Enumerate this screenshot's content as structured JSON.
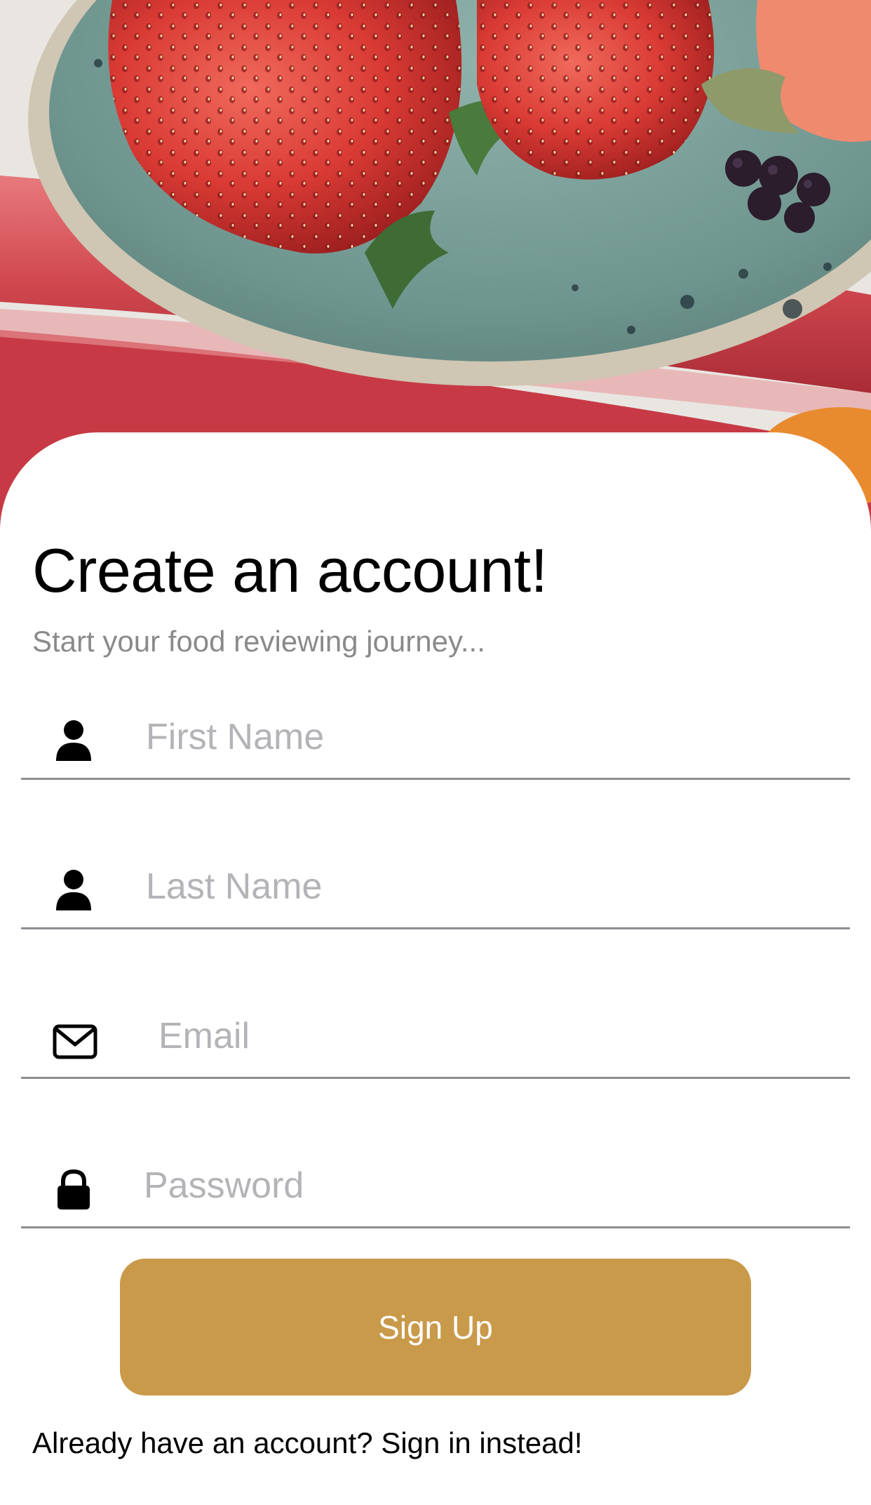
{
  "hero": {
    "image_subject": "strawberries-on-plate-photo"
  },
  "heading": {
    "title": "Create an account!",
    "subtitle": "Start your food reviewing journey..."
  },
  "form": {
    "first_name": {
      "placeholder": "First Name",
      "value": "",
      "icon": "person-icon"
    },
    "last_name": {
      "placeholder": "Last Name",
      "value": "",
      "icon": "person-icon"
    },
    "email": {
      "placeholder": "Email",
      "value": "",
      "icon": "envelope-icon"
    },
    "password": {
      "placeholder": "Password",
      "value": "",
      "icon": "lock-icon"
    }
  },
  "actions": {
    "signup_label": "Sign Up",
    "signin_label": "Already have an account? Sign in instead!"
  },
  "colors": {
    "accent": "#c99a4a",
    "divider": "#8e8e93",
    "placeholder": "#b4b4b8",
    "subtitle": "#8a8a8a"
  }
}
